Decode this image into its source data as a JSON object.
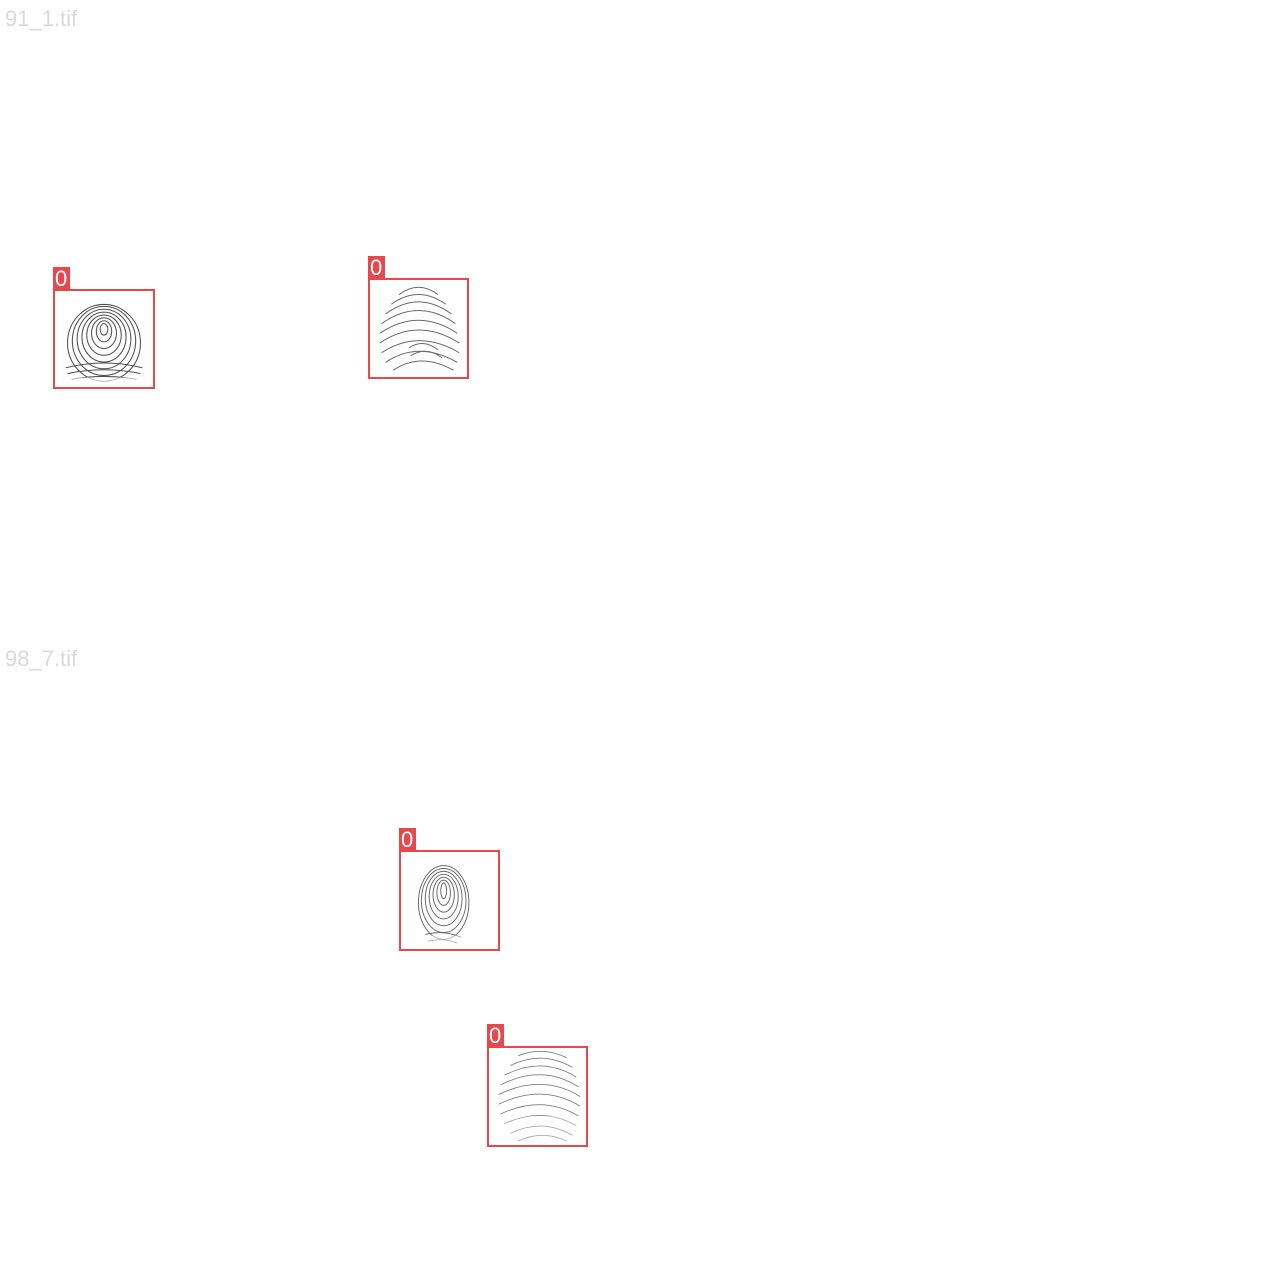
{
  "panels": [
    {
      "filename": "91_1.tif",
      "detections": [
        {
          "class_label": "0"
        },
        {
          "class_label": "0"
        }
      ]
    },
    {
      "filename": "98_7.tif",
      "detections": [
        {
          "class_label": "0"
        },
        {
          "class_label": "0"
        }
      ]
    }
  ],
  "colors": {
    "box": "#e8474b",
    "label_text": "#ffffff",
    "filename_text": "#dadada",
    "ridge": "#333333"
  },
  "icons": [
    "fingerprint-image"
  ]
}
